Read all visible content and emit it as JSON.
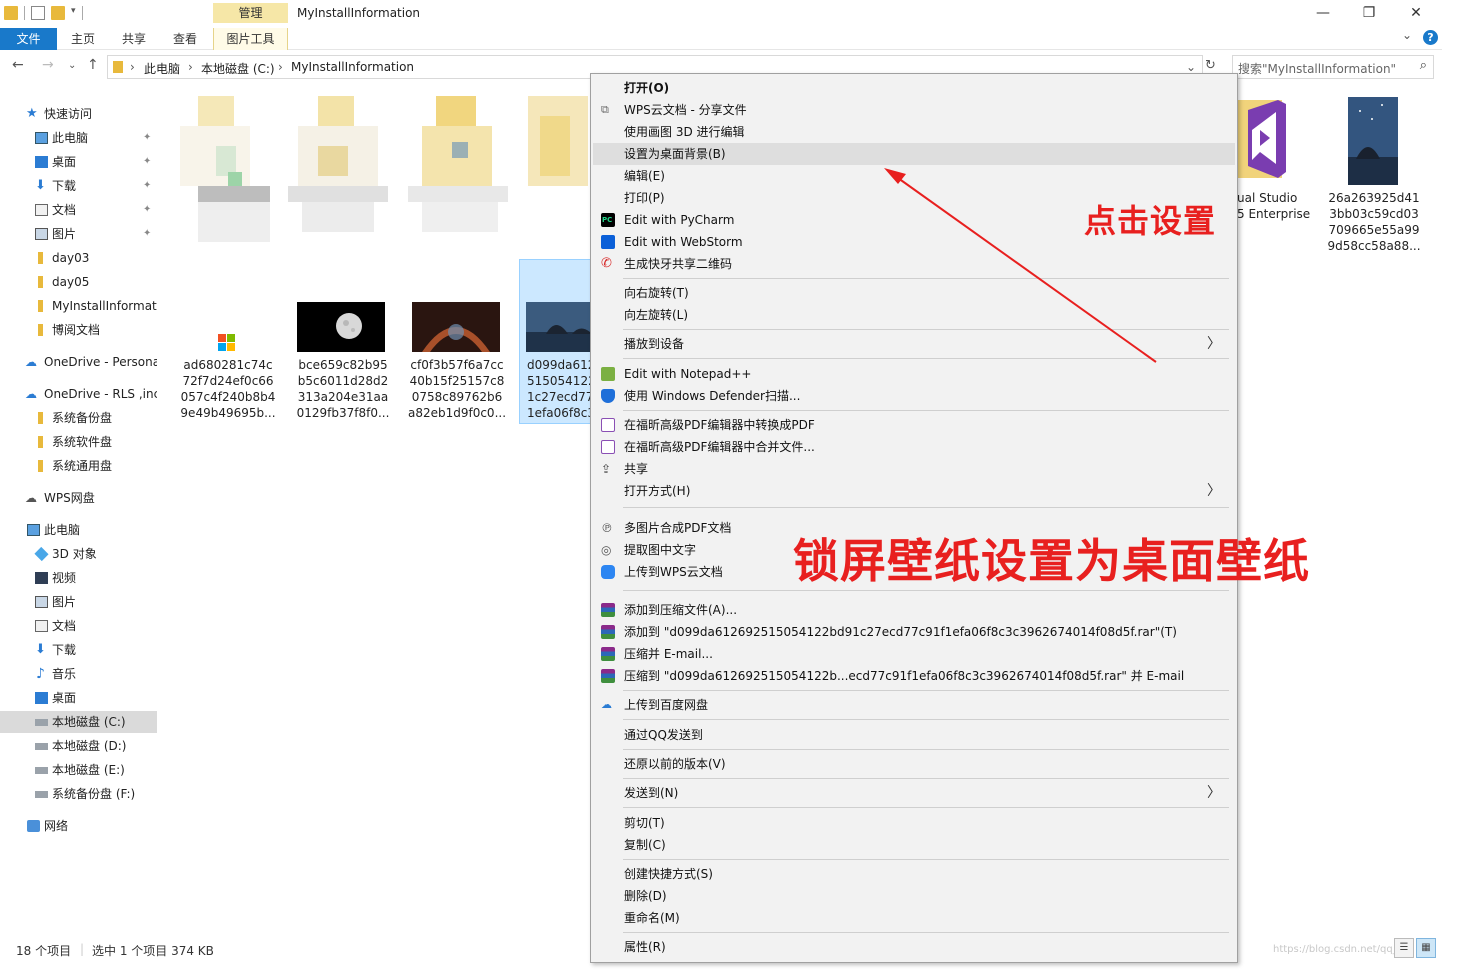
{
  "window": {
    "title": "MyInstallInformation",
    "context_tab_group": "管理",
    "minimize": "—",
    "maximize": "❐",
    "close": "✕"
  },
  "ribbon": {
    "tabs": [
      "文件",
      "主页",
      "共享",
      "查看",
      "图片工具"
    ],
    "help": "?"
  },
  "address": {
    "crumbs": [
      "此电脑",
      "本地磁盘 (C:)",
      "MyInstallInformation"
    ],
    "search_placeholder": "搜索\"MyInstallInformation\""
  },
  "nav_pane": {
    "items": [
      {
        "label": "快速访问",
        "icon": "star-icon"
      },
      {
        "label": "此电脑",
        "icon": "computer-icon",
        "pinned": true
      },
      {
        "label": "桌面",
        "icon": "desktop-icon",
        "pinned": true
      },
      {
        "label": "下载",
        "icon": "download-icon",
        "pinned": true
      },
      {
        "label": "文档",
        "icon": "document-icon",
        "pinned": true
      },
      {
        "label": "图片",
        "icon": "pictures-icon",
        "pinned": true
      },
      {
        "label": "day03",
        "icon": "folder-icon"
      },
      {
        "label": "day05",
        "icon": "folder-icon"
      },
      {
        "label": "MyInstallInformati",
        "icon": "folder-icon"
      },
      {
        "label": "博阅文档",
        "icon": "folder-icon"
      },
      {
        "label": "OneDrive - Persona",
        "icon": "cloud-icon"
      },
      {
        "label": "OneDrive - RLS ,inc",
        "icon": "cloud-icon"
      },
      {
        "label": "系统备份盘",
        "icon": "folder-icon"
      },
      {
        "label": "系统软件盘",
        "icon": "folder-icon"
      },
      {
        "label": "系统通用盘",
        "icon": "folder-icon"
      },
      {
        "label": "WPS网盘",
        "icon": "cloud-icon"
      },
      {
        "label": "此电脑",
        "icon": "computer-icon"
      },
      {
        "label": "3D 对象",
        "icon": "3d-objects-icon"
      },
      {
        "label": "视频",
        "icon": "video-icon"
      },
      {
        "label": "图片",
        "icon": "pictures-icon"
      },
      {
        "label": "文档",
        "icon": "document-icon"
      },
      {
        "label": "下载",
        "icon": "download-icon"
      },
      {
        "label": "音乐",
        "icon": "music-icon"
      },
      {
        "label": "桌面",
        "icon": "desktop-icon"
      },
      {
        "label": "本地磁盘 (C:)",
        "icon": "drive-icon",
        "selected": true
      },
      {
        "label": "本地磁盘 (D:)",
        "icon": "drive-icon"
      },
      {
        "label": "本地磁盘 (E:)",
        "icon": "drive-icon"
      },
      {
        "label": "系统备份盘 (F:)",
        "icon": "drive-icon"
      },
      {
        "label": "网络",
        "icon": "network-icon"
      }
    ],
    "pin_glyph": "📌"
  },
  "files": [
    {
      "name": "ad680281c74c\n72f7d24ef0c66\n057c4f240b8b4\n9e49b49695b..."
    },
    {
      "name": "bce659c82b95\nb5c6011d28d2\n313a204e31aa\n0129fb37f8f0..."
    },
    {
      "name": "cf0f3b57f6a7cc\n40b15f25157c8\n0758c89762b6\na82eb1d9f0c0..."
    },
    {
      "name": "d099da612\n515054122\n1c27ecd77\n1efa06f8c3"
    },
    {
      "name": "ual Studio\n5 Enterprise"
    },
    {
      "name": "26a263925d41\n3bb03c59cd03\n709665e55a99\n9d58cc58a88..."
    }
  ],
  "context_menu": {
    "items": [
      {
        "label": "打开(O)",
        "bold": true
      },
      {
        "label": "WPS云文档 - 分享文件",
        "icon": "wps-share-icon"
      },
      {
        "label": "使用画图 3D 进行编辑"
      },
      {
        "label": "设置为桌面背景(B)",
        "highlight": true
      },
      {
        "label": "编辑(E)"
      },
      {
        "label": "打印(P)"
      },
      {
        "label": "Edit with PyCharm",
        "icon": "pycharm-icon"
      },
      {
        "label": "Edit with WebStorm",
        "icon": "webstorm-icon"
      },
      {
        "label": "生成快牙共享二维码",
        "icon": "qr-share-icon"
      },
      {
        "label": "向右旋转(T)"
      },
      {
        "label": "向左旋转(L)"
      },
      {
        "label": "播放到设备",
        "submenu": true
      },
      {
        "label": "Edit with Notepad++",
        "icon": "notepadpp-icon"
      },
      {
        "label": "使用 Windows Defender扫描...",
        "icon": "defender-icon"
      },
      {
        "label": "在福昕高级PDF编辑器中转换成PDF",
        "icon": "foxit-pdf-icon"
      },
      {
        "label": "在福昕高级PDF编辑器中合并文件...",
        "icon": "foxit-pdf-icon"
      },
      {
        "label": "共享",
        "icon": "share-icon"
      },
      {
        "label": "打开方式(H)",
        "submenu": true
      },
      {
        "label": "多图片合成PDF文档",
        "icon": "pdf-merge-icon"
      },
      {
        "label": "提取图中文字",
        "icon": "ocr-icon"
      },
      {
        "label": "上传到WPS云文档",
        "icon": "wps-cloud-icon"
      },
      {
        "label": "添加到压缩文件(A)...",
        "icon": "winrar-icon"
      },
      {
        "label": "添加到 \"d099da612692515054122bd91c27ecd77c91f1efa06f8c3c3962674014f08d5f.rar\"(T)",
        "icon": "winrar-icon"
      },
      {
        "label": "压缩并 E-mail...",
        "icon": "winrar-icon"
      },
      {
        "label": "压缩到 \"d099da612692515054122b...ecd77c91f1efa06f8c3c3962674014f08d5f.rar\" 并 E-mail",
        "icon": "winrar-icon"
      },
      {
        "label": "上传到百度网盘",
        "icon": "baidu-cloud-icon"
      },
      {
        "label": "通过QQ发送到"
      },
      {
        "label": "还原以前的版本(V)"
      },
      {
        "label": "发送到(N)",
        "submenu": true
      },
      {
        "label": "剪切(T)"
      },
      {
        "label": "复制(C)"
      },
      {
        "label": "创建快捷方式(S)"
      },
      {
        "label": "删除(D)"
      },
      {
        "label": "重命名(M)"
      },
      {
        "label": "属性(R)"
      }
    ],
    "submenu_glyph": "〉"
  },
  "status": {
    "count": "18 个项目",
    "selection": "选中 1 个项目  374 KB"
  },
  "annotations": {
    "click_hint": "点击设置",
    "caption": "锁屏壁纸设置为桌面壁纸",
    "color": "#e8201f"
  },
  "watermark": "https://blog.csdn.net/qq_..."
}
